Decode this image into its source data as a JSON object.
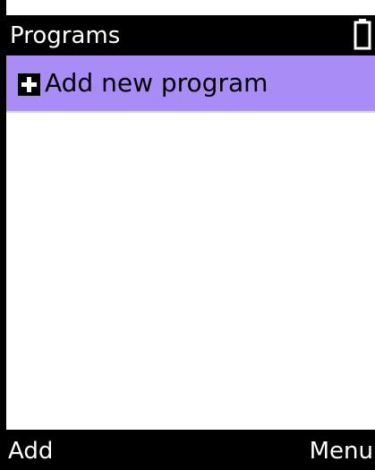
{
  "title_bar": {
    "title": "Programs",
    "status_icon": "battery-icon"
  },
  "list": {
    "items": [
      {
        "label": "Add new program",
        "icon": "plus-icon",
        "selected": true
      }
    ]
  },
  "softkeys": {
    "left": "Add",
    "right": "Menu"
  },
  "colors": {
    "bar_background": "#000000",
    "bar_text": "#ffffff",
    "selection": "#a98cf5",
    "background": "#ffffff"
  }
}
